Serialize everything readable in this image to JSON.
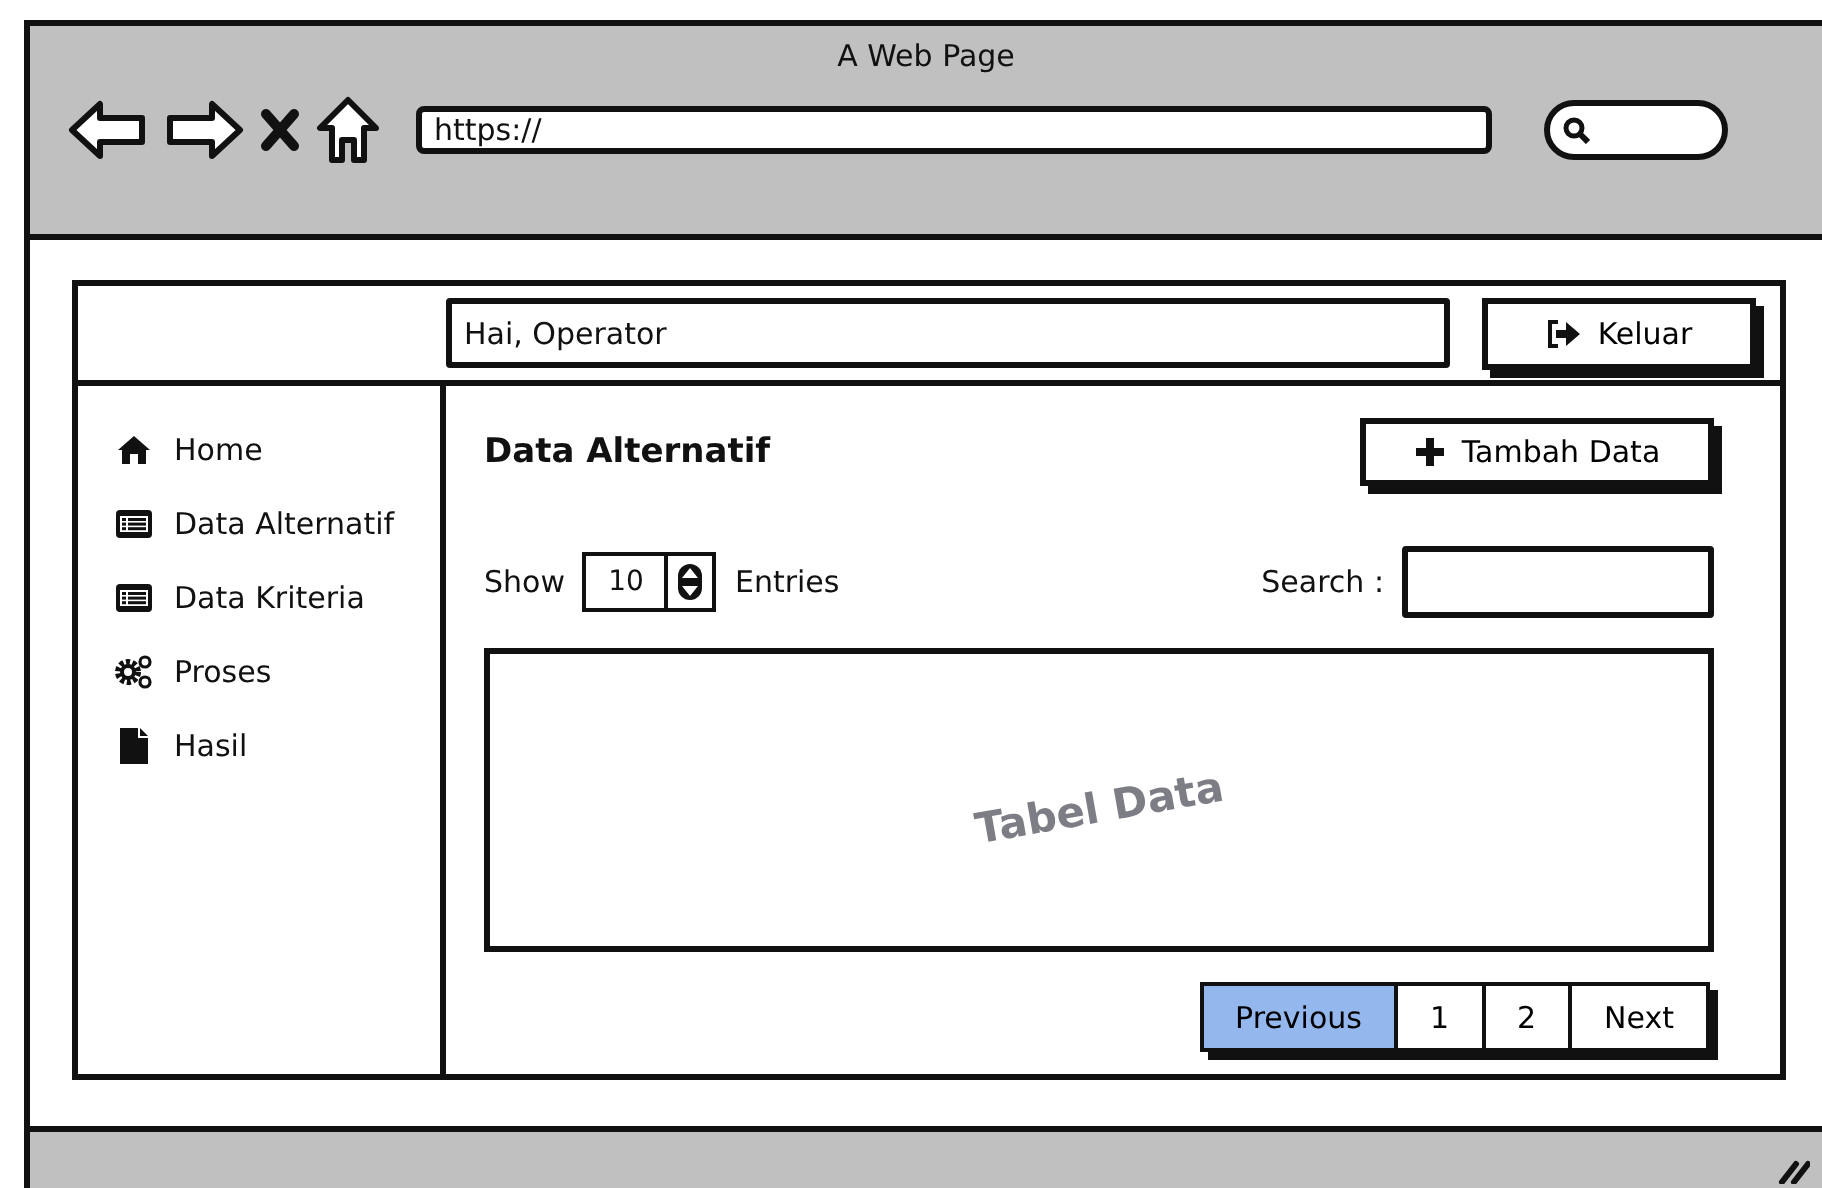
{
  "window": {
    "title": "A Web Page",
    "address": "https://"
  },
  "header": {
    "greeting": "Hai, Operator",
    "logout_button": "Keluar"
  },
  "sidebar": {
    "items": [
      {
        "label": "Home"
      },
      {
        "label": "Data Alternatif"
      },
      {
        "label": "Data Kriteria"
      },
      {
        "label": "Proses"
      },
      {
        "label": "Hasil"
      }
    ]
  },
  "main": {
    "title": "Data Alternatif",
    "add_button": "Tambah Data",
    "show_label": "Show",
    "entries_value": "10",
    "entries_label": "Entries",
    "search_label": "Search :",
    "table_placeholder": "Tabel Data",
    "pagination": [
      {
        "label": "Previous",
        "selected": true
      },
      {
        "label": "1",
        "selected": false
      },
      {
        "label": "2",
        "selected": false
      },
      {
        "label": "Next",
        "selected": false
      }
    ]
  }
}
